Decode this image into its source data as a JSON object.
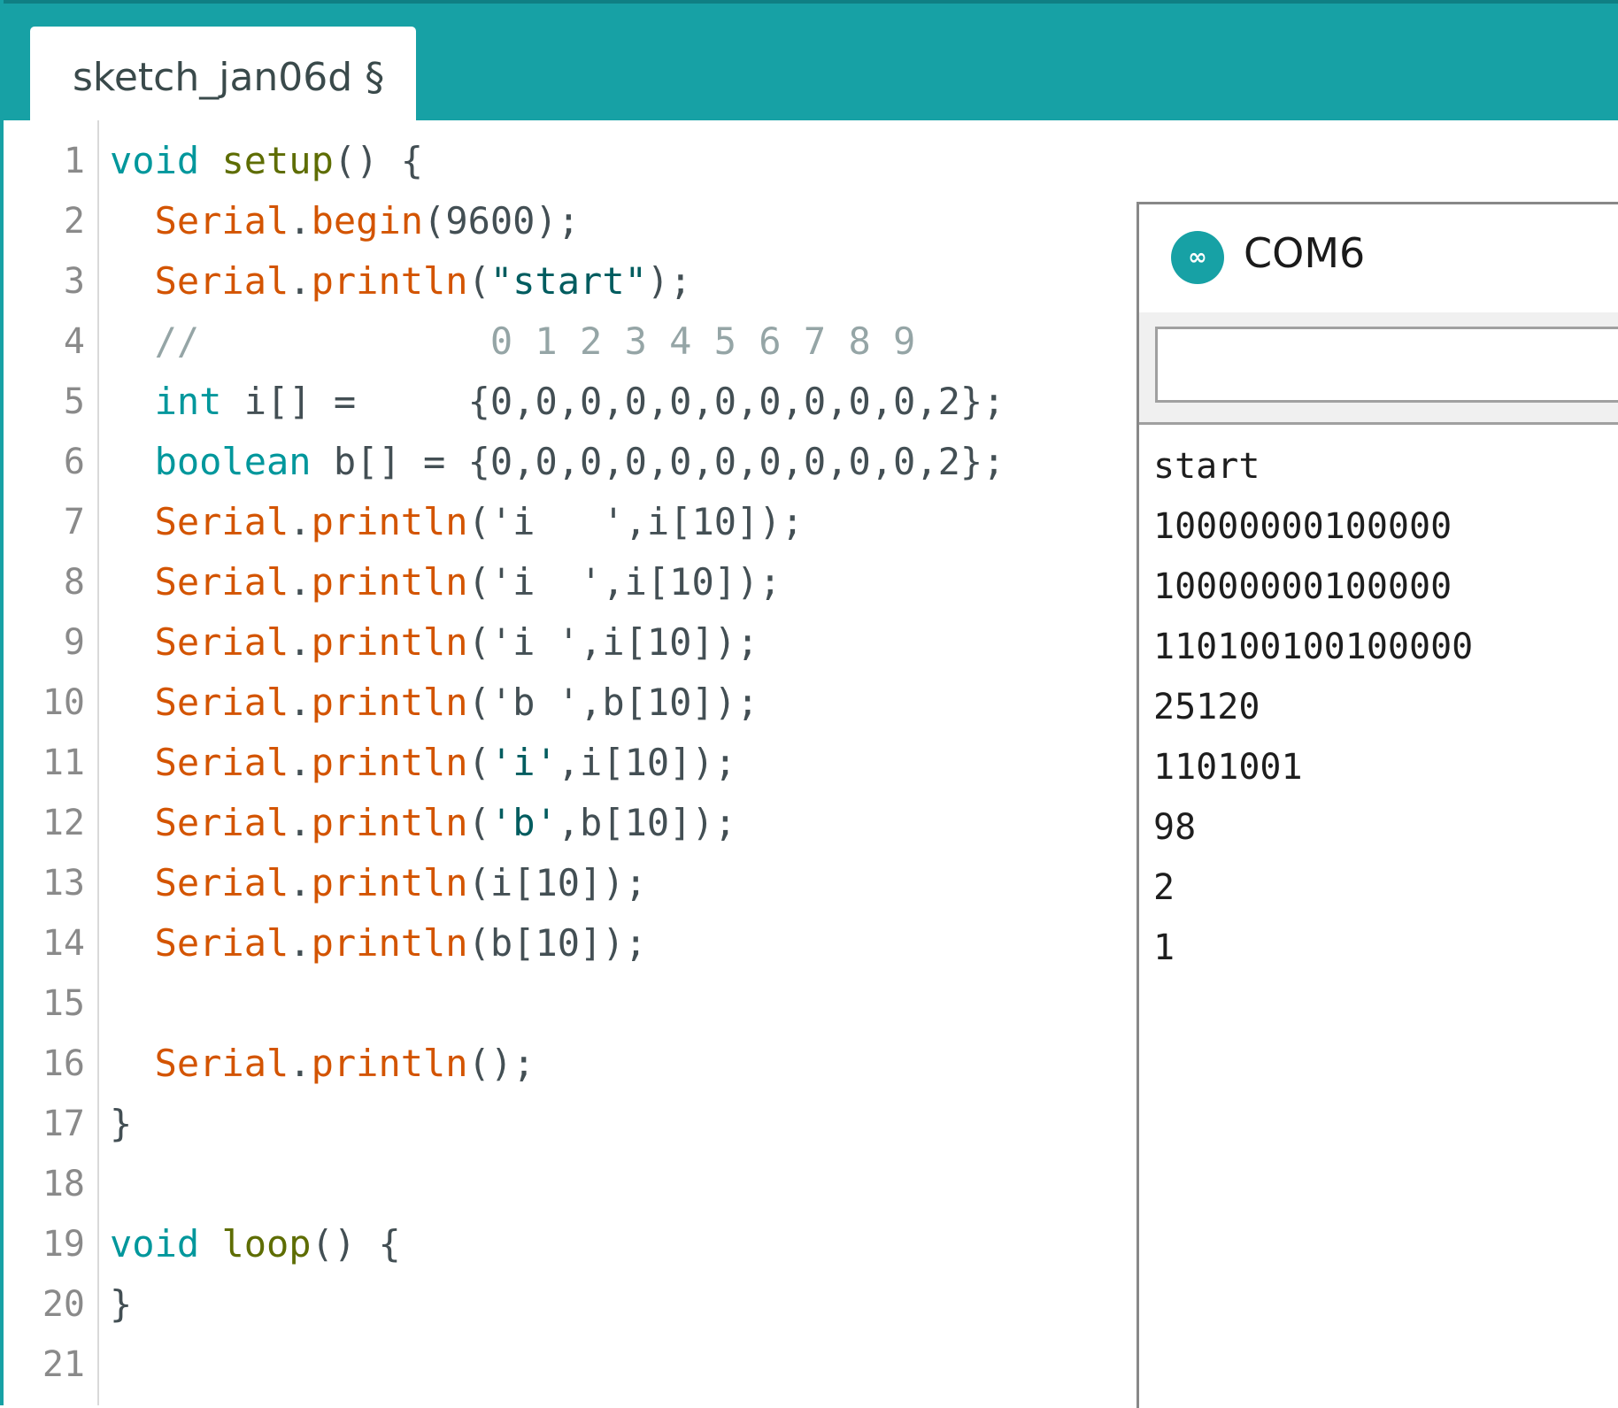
{
  "tab": {
    "label": "sketch_jan06d §"
  },
  "editor": {
    "line_numbers": [
      "1",
      "2",
      "3",
      "4",
      "5",
      "6",
      "7",
      "8",
      "9",
      "10",
      "11",
      "12",
      "13",
      "14",
      "15",
      "16",
      "17",
      "18",
      "19",
      "20",
      "21"
    ],
    "lines": [
      [
        {
          "t": "void",
          "c": "kw"
        },
        {
          "t": " "
        },
        {
          "t": "setup",
          "c": "fn"
        },
        {
          "t": "() {"
        }
      ],
      [
        {
          "t": "  "
        },
        {
          "t": "Serial",
          "c": "sr"
        },
        {
          "t": "."
        },
        {
          "t": "begin",
          "c": "sr"
        },
        {
          "t": "(9600);"
        }
      ],
      [
        {
          "t": "  "
        },
        {
          "t": "Serial",
          "c": "sr"
        },
        {
          "t": "."
        },
        {
          "t": "println",
          "c": "sr"
        },
        {
          "t": "("
        },
        {
          "t": "\"start\"",
          "c": "st"
        },
        {
          "t": ");"
        }
      ],
      [
        {
          "t": "  //             0 1 2 3 4 5 6 7 8 9",
          "c": "cm"
        }
      ],
      [
        {
          "t": "  "
        },
        {
          "t": "int",
          "c": "kw"
        },
        {
          "t": " i[] =     {0,0,0,0,0,0,0,0,0,0,2};"
        }
      ],
      [
        {
          "t": "  "
        },
        {
          "t": "boolean",
          "c": "kw"
        },
        {
          "t": " b[] = {0,0,0,0,0,0,0,0,0,0,2};"
        }
      ],
      [
        {
          "t": "  "
        },
        {
          "t": "Serial",
          "c": "sr"
        },
        {
          "t": "."
        },
        {
          "t": "println",
          "c": "sr"
        },
        {
          "t": "('i   ',i[10]);"
        }
      ],
      [
        {
          "t": "  "
        },
        {
          "t": "Serial",
          "c": "sr"
        },
        {
          "t": "."
        },
        {
          "t": "println",
          "c": "sr"
        },
        {
          "t": "('i  ',i[10]);"
        }
      ],
      [
        {
          "t": "  "
        },
        {
          "t": "Serial",
          "c": "sr"
        },
        {
          "t": "."
        },
        {
          "t": "println",
          "c": "sr"
        },
        {
          "t": "('i ',i[10]);"
        }
      ],
      [
        {
          "t": "  "
        },
        {
          "t": "Serial",
          "c": "sr"
        },
        {
          "t": "."
        },
        {
          "t": "println",
          "c": "sr"
        },
        {
          "t": "('b ',b[10]);"
        }
      ],
      [
        {
          "t": "  "
        },
        {
          "t": "Serial",
          "c": "sr"
        },
        {
          "t": "."
        },
        {
          "t": "println",
          "c": "sr"
        },
        {
          "t": "("
        },
        {
          "t": "'i'",
          "c": "st"
        },
        {
          "t": ",i[10]);"
        }
      ],
      [
        {
          "t": "  "
        },
        {
          "t": "Serial",
          "c": "sr"
        },
        {
          "t": "."
        },
        {
          "t": "println",
          "c": "sr"
        },
        {
          "t": "("
        },
        {
          "t": "'b'",
          "c": "st"
        },
        {
          "t": ",b[10]);"
        }
      ],
      [
        {
          "t": "  "
        },
        {
          "t": "Serial",
          "c": "sr"
        },
        {
          "t": "."
        },
        {
          "t": "println",
          "c": "sr"
        },
        {
          "t": "(i[10]);"
        }
      ],
      [
        {
          "t": "  "
        },
        {
          "t": "Serial",
          "c": "sr"
        },
        {
          "t": "."
        },
        {
          "t": "println",
          "c": "sr"
        },
        {
          "t": "(b[10]);"
        }
      ],
      [],
      [
        {
          "t": "  "
        },
        {
          "t": "Serial",
          "c": "sr"
        },
        {
          "t": "."
        },
        {
          "t": "println",
          "c": "sr"
        },
        {
          "t": "();"
        }
      ],
      [
        {
          "t": "}"
        }
      ],
      [],
      [
        {
          "t": "void",
          "c": "kw"
        },
        {
          "t": " "
        },
        {
          "t": "loop",
          "c": "fn"
        },
        {
          "t": "() {"
        }
      ],
      [
        {
          "t": "}"
        }
      ],
      []
    ]
  },
  "monitor": {
    "title": "COM6",
    "icon": "arduino-logo-icon",
    "icon_glyph": "∞",
    "input_value": "",
    "output": [
      "start",
      "10000000100000",
      "10000000100000",
      "110100100100000",
      "25120",
      "1101001",
      "98",
      "2",
      "1"
    ]
  },
  "colors": {
    "accent": "#17a1a5",
    "keyword": "#00979c",
    "function": "#5e6d03",
    "serial": "#d35400",
    "string": "#005c5f",
    "comment": "#95a5a6"
  }
}
